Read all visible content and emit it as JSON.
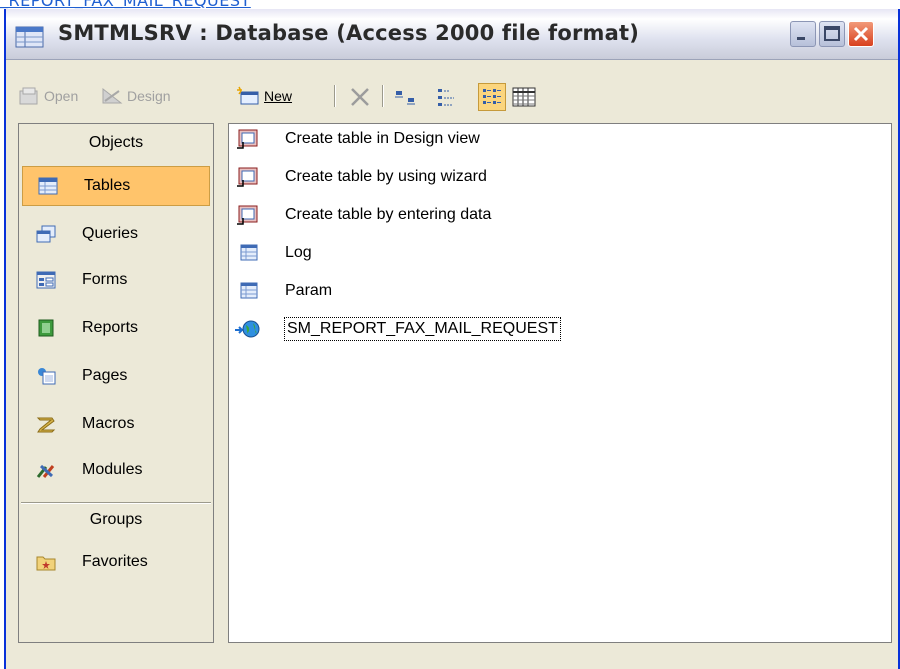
{
  "page_heading": "_REPORT_FAX_MAIL_REQUEST",
  "window": {
    "title": "SMTMLSRV : Database (Access 2000 file format)"
  },
  "toolbar": {
    "open": "Open",
    "design": "Design",
    "new": "New"
  },
  "sidebar": {
    "objects_header": "Objects",
    "groups_header": "Groups",
    "items": [
      {
        "label": "Tables",
        "icon": "table-icon"
      },
      {
        "label": "Queries",
        "icon": "query-icon"
      },
      {
        "label": "Forms",
        "icon": "form-icon"
      },
      {
        "label": "Reports",
        "icon": "report-icon"
      },
      {
        "label": "Pages",
        "icon": "page-icon"
      },
      {
        "label": "Macros",
        "icon": "macro-icon"
      },
      {
        "label": "Modules",
        "icon": "module-icon"
      }
    ],
    "groups": [
      {
        "label": "Favorites",
        "icon": "favorites-folder-icon"
      }
    ]
  },
  "objects": [
    {
      "label": "Create table in Design view",
      "icon": "shortcut-wizard-icon"
    },
    {
      "label": "Create table by using wizard",
      "icon": "shortcut-wizard-icon"
    },
    {
      "label": "Create table by entering data",
      "icon": "shortcut-wizard-icon"
    },
    {
      "label": "Log",
      "icon": "table-icon"
    },
    {
      "label": "Param",
      "icon": "table-icon"
    },
    {
      "label": "SM_REPORT_FAX_MAIL_REQUEST",
      "icon": "linked-table-globe-icon"
    }
  ],
  "colors": {
    "selected_bg": "#ffc46b",
    "close_button": "#d8401e",
    "window_border": "#0831d9"
  }
}
